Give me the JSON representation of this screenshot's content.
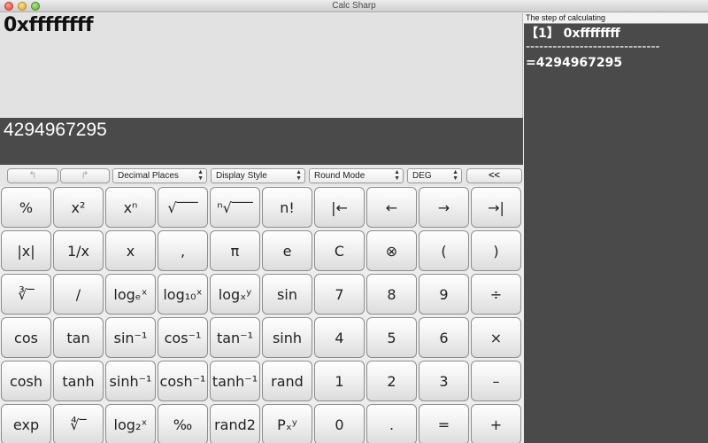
{
  "window": {
    "title": "Calc Sharp"
  },
  "display": {
    "input": "0xffffffff",
    "result": "4294967295"
  },
  "toolbar": {
    "undo_label": "↰",
    "redo_label": "↱",
    "decimal_places": "Decimal Places",
    "display_style": "Display Style",
    "round_mode": "Round Mode",
    "angle_mode": "DEG",
    "collapse_label": "<<"
  },
  "keys": {
    "row1": [
      "%",
      "x²",
      "xⁿ",
      "√‾‾‾",
      "ⁿ√‾‾‾",
      "n!",
      "|←",
      "←",
      "→",
      "→|"
    ],
    "row2": [
      "|x|",
      "1/x",
      "x",
      ",",
      "π",
      "e",
      "C",
      "⊗",
      "(",
      ")"
    ],
    "row3": [
      "∛‾",
      "/",
      "logₑˣ",
      "log₁₀ˣ",
      "logₓʸ",
      "sin",
      "7",
      "8",
      "9",
      "÷"
    ],
    "row4": [
      "cos",
      "tan",
      "sin⁻¹",
      "cos⁻¹",
      "tan⁻¹",
      "sinh",
      "4",
      "5",
      "6",
      "×"
    ],
    "row5": [
      "cosh",
      "tanh",
      "sinh⁻¹",
      "cosh⁻¹",
      "tanh⁻¹",
      "rand",
      "1",
      "2",
      "3",
      "–"
    ],
    "row6": [
      "exp",
      "∜‾",
      "log₂ˣ",
      "‰",
      "rand2",
      "Pₓʸ",
      "0",
      ".",
      "=",
      "+"
    ]
  },
  "steps": {
    "header": "The step of calculating",
    "line1": "【1】 0xffffffff",
    "separator": "------------------------------",
    "line2": "=4294967295"
  }
}
